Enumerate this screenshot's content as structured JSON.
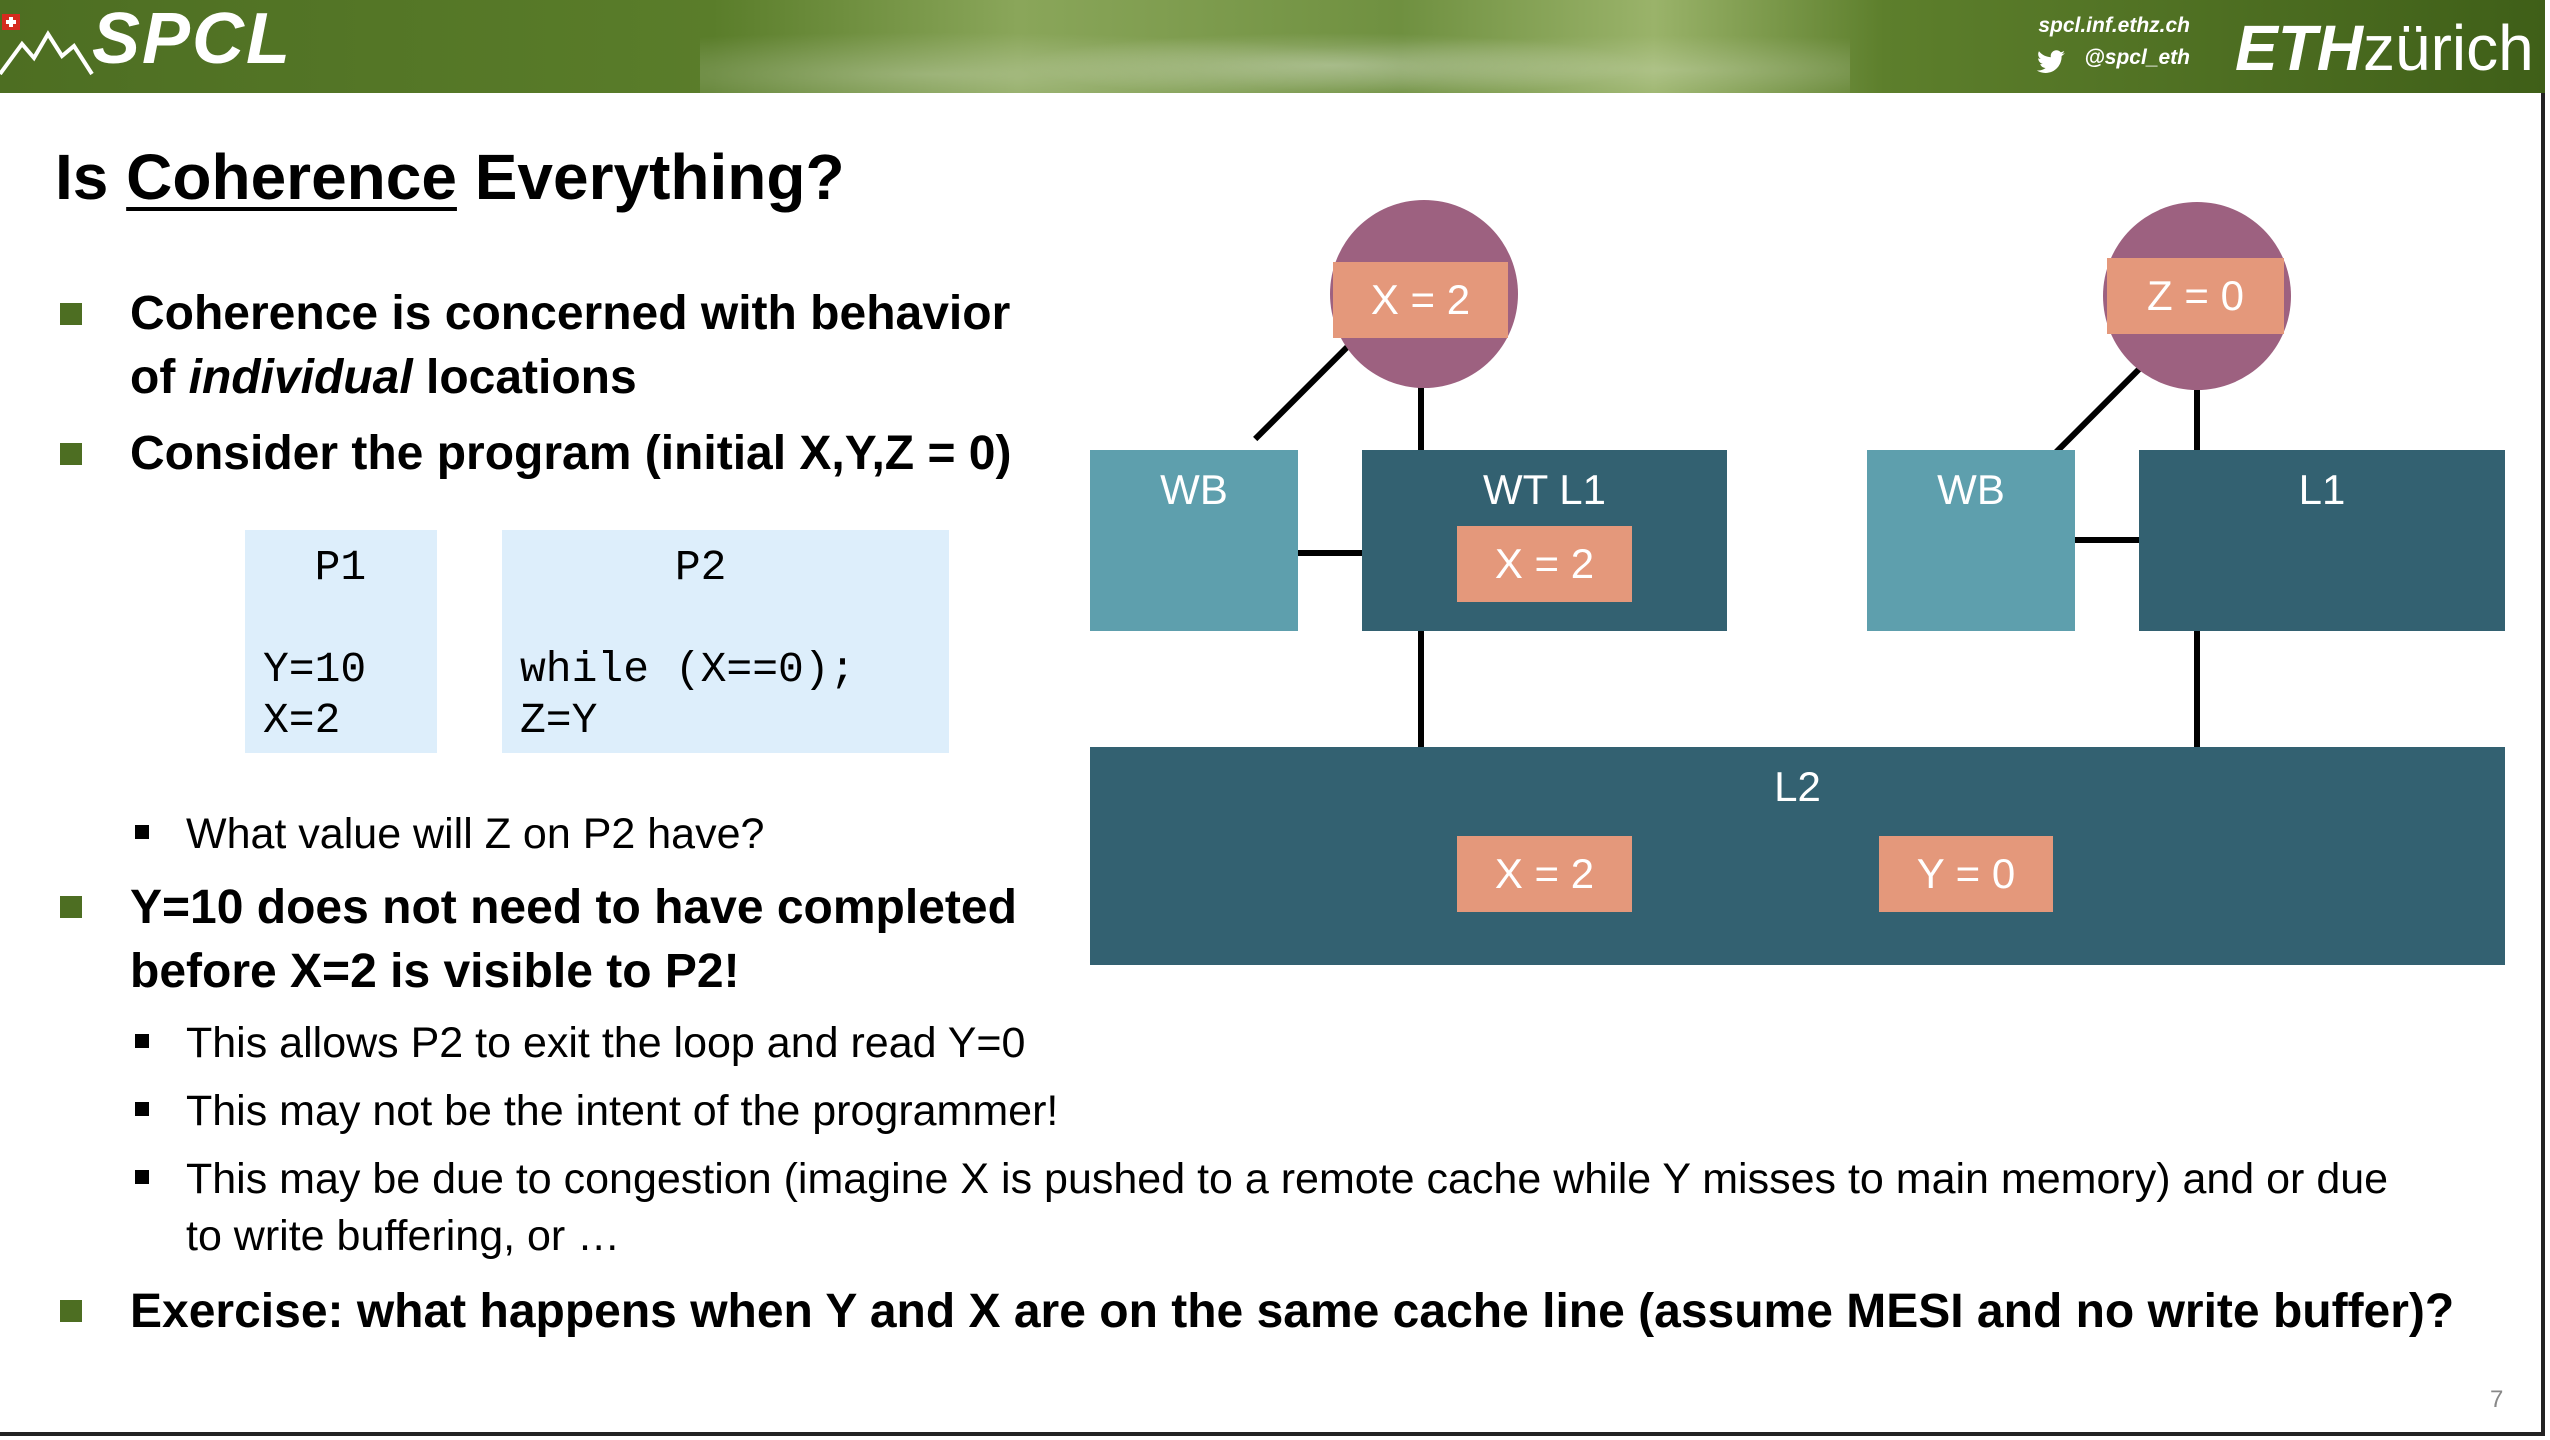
{
  "header": {
    "logo_text": "SPCL",
    "url": "spcl.inf.ethz.ch",
    "twitter": "@spcl_eth",
    "eth_bold": "ETH",
    "eth_light": "zürich"
  },
  "slide": {
    "title_pre": "Is ",
    "title_underlined": "Coherence",
    "title_post": " Everything?",
    "bullet1_line1": "Coherence is concerned with behavior",
    "bullet1_line2_pre": "of ",
    "bullet1_line2_italic": "individual",
    "bullet1_line2_post": " locations",
    "bullet2": "Consider the program (initial X,Y,Z = 0)",
    "code_p1": "  P1\n\nY=10\nX=2",
    "code_p2": "      P2\n\nwhile (X==0);\nZ=Y",
    "sub1": "What value will Z on P2 have?",
    "bullet3_line1": "Y=10 does not need to have completed",
    "bullet3_line2": "before X=2 is visible to P2!",
    "sub2": "This allows P2 to exit the loop and read Y=0",
    "sub3": "This may not be the intent of the programmer!",
    "sub4_line1": "This may be due to congestion (imagine X is pushed to a remote cache while Y misses to main memory) and or due",
    "sub4_line2": "to write buffering, or …",
    "bullet4": "Exercise: what happens when Y and X are on the same cache line (assume MESI and no write buffer)?",
    "page_number": "7"
  },
  "diagram": {
    "core1_tag": "X = 2",
    "core2_tag": "Z = 0",
    "wb1_label": "WB",
    "l1a_label": "WT L1",
    "l1a_tag": "X = 2",
    "wb2_label": "WB",
    "l1b_label": "L1",
    "l2_label": "L2",
    "l2_tag_x": "X = 2",
    "l2_tag_y": "Y = 0",
    "colors": {
      "wb": "#5e9fad",
      "cache": "#336171",
      "tag": "#e4987b",
      "core": "#9d6180"
    }
  }
}
